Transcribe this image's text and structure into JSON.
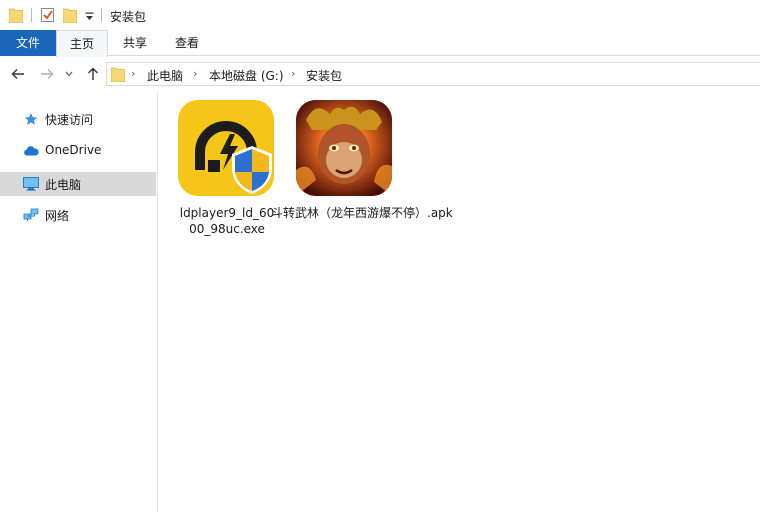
{
  "window": {
    "title": "安装包"
  },
  "ribbon": {
    "tabs": [
      {
        "label": "文件"
      },
      {
        "label": "主页"
      },
      {
        "label": "共享"
      },
      {
        "label": "查看"
      }
    ]
  },
  "address": {
    "crumbs": [
      "此电脑",
      "本地磁盘 (G:)",
      "安装包"
    ]
  },
  "sidebar": {
    "items": [
      {
        "label": "快速访问",
        "icon": "star-pin-icon"
      },
      {
        "label": "OneDrive",
        "icon": "cloud-icon"
      },
      {
        "label": "此电脑",
        "icon": "monitor-icon",
        "selected": true
      },
      {
        "label": "网络",
        "icon": "network-icon"
      }
    ]
  },
  "files": [
    {
      "name_line1": "ldplayer9_ld_60",
      "name_line2": "00_98uc.exe",
      "icon": "ldplayer-installer-icon"
    },
    {
      "name_line1": "斗转武林（龙年西游爆不停）.apk",
      "icon": "game-apk-icon"
    }
  ],
  "colors": {
    "file_tab": "#1a66b8",
    "selected_sidebar": "#d9d9d9",
    "folder_yellow": "#f8d775",
    "ldplayer_yellow": "#f5c518"
  }
}
